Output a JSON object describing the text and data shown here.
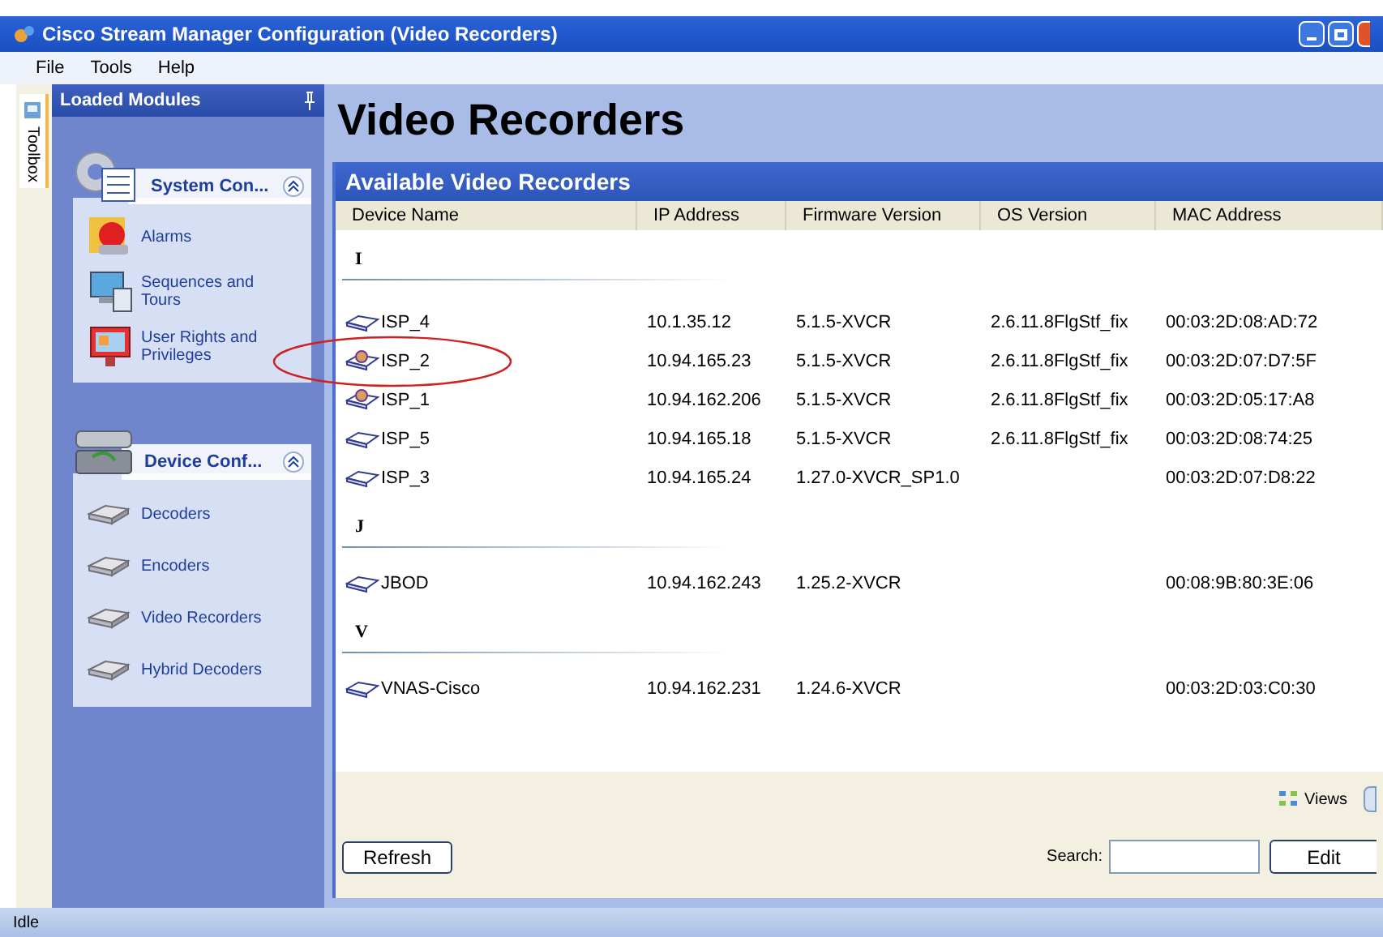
{
  "window": {
    "title": "Cisco Stream Manager Configuration (Video Recorders)"
  },
  "menu": [
    {
      "label": "File"
    },
    {
      "label": "Tools"
    },
    {
      "label": "Help"
    }
  ],
  "toolbox_tab": {
    "label": "Toolbox"
  },
  "sidebar": {
    "title": "Loaded Modules",
    "groups": [
      {
        "title": "System Con...",
        "kind": "system",
        "expanded": true,
        "items": [
          {
            "label": "Alarms",
            "kind": "alarm"
          },
          {
            "label": "Sequences and Tours",
            "kind": "sequence"
          },
          {
            "label": "User Rights and Privileges",
            "kind": "rights"
          }
        ]
      },
      {
        "title": "Device Conf...",
        "kind": "device",
        "expanded": true,
        "items": [
          {
            "label": "Decoders",
            "kind": "drive"
          },
          {
            "label": "Encoders",
            "kind": "drive"
          },
          {
            "label": "Video Recorders",
            "kind": "drive"
          },
          {
            "label": "Hybrid Decoders",
            "kind": "drive"
          }
        ]
      }
    ]
  },
  "page_title": "Video Recorders",
  "panel_title": "Available Video Recorders",
  "table": {
    "columns": [
      "Device Name",
      "IP Address",
      "Firmware Version",
      "OS Version",
      "MAC Address"
    ],
    "groups": [
      {
        "letter": "I",
        "rows": [
          {
            "kind": "recorder",
            "circled": false,
            "cells": [
              "ISP_4",
              "10.1.35.12",
              "5.1.5-XVCR",
              "2.6.11.8FlgStf_fix",
              "00:03:2D:08:AD:72"
            ]
          },
          {
            "kind": "recorder_user",
            "circled": true,
            "cells": [
              "ISP_2",
              "10.94.165.23",
              "5.1.5-XVCR",
              "2.6.11.8FlgStf_fix",
              "00:03:2D:07:D7:5F"
            ]
          },
          {
            "kind": "recorder_user",
            "circled": false,
            "cells": [
              "ISP_1",
              "10.94.162.206",
              "5.1.5-XVCR",
              "2.6.11.8FlgStf_fix",
              "00:03:2D:05:17:A8"
            ]
          },
          {
            "kind": "recorder",
            "circled": false,
            "cells": [
              "ISP_5",
              "10.94.165.18",
              "5.1.5-XVCR",
              "2.6.11.8FlgStf_fix",
              "00:03:2D:08:74:25"
            ]
          },
          {
            "kind": "recorder",
            "circled": false,
            "cells": [
              "ISP_3",
              "10.94.165.24",
              "1.27.0-XVCR_SP1.0",
              "",
              "00:03:2D:07:D8:22"
            ]
          }
        ]
      },
      {
        "letter": "J",
        "rows": [
          {
            "kind": "recorder",
            "circled": false,
            "cells": [
              "JBOD",
              "10.94.162.243",
              "1.25.2-XVCR",
              "",
              "00:08:9B:80:3E:06"
            ]
          }
        ]
      },
      {
        "letter": "V",
        "rows": [
          {
            "kind": "recorder",
            "circled": false,
            "cells": [
              "VNAS-Cisco",
              "10.94.162.231",
              "1.24.6-XVCR",
              "",
              "00:03:2D:03:C0:30"
            ]
          }
        ]
      }
    ]
  },
  "footer": {
    "views_label": "Views",
    "refresh_button": "Refresh",
    "search_label": "Search:",
    "edit_button": "Edit"
  },
  "status_bar": "Idle"
}
